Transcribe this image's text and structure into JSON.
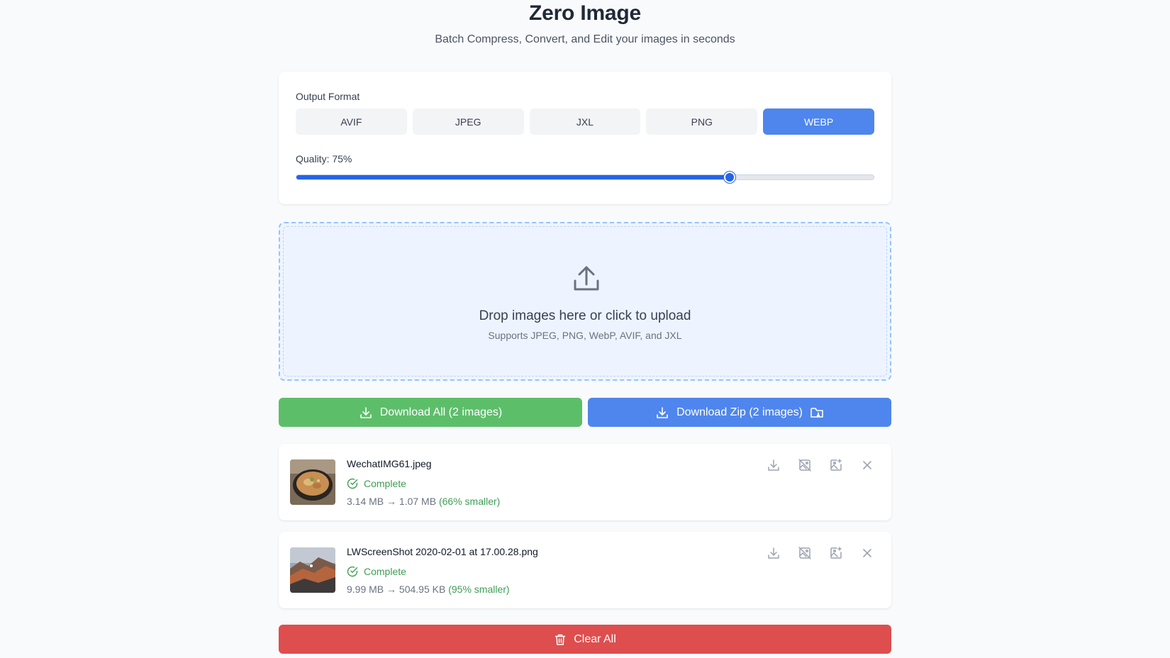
{
  "header": {
    "title": "Zero Image",
    "subtitle": "Batch Compress, Convert, and Edit your images in seconds"
  },
  "settings": {
    "format_label": "Output Format",
    "formats": [
      "AVIF",
      "JPEG",
      "JXL",
      "PNG",
      "WEBP"
    ],
    "selected_format": "WEBP",
    "quality_label": "Quality: 75%",
    "quality_value": 75
  },
  "dropzone": {
    "icon": "upload-icon",
    "title": "Drop images here or click to upload",
    "subtitle": "Supports JPEG, PNG, WebP, AVIF, and JXL"
  },
  "download": {
    "all_label": "Download All (2 images)",
    "zip_label": "Download Zip (2 images)"
  },
  "files": [
    {
      "name": "WechatIMG61.jpeg",
      "status": "Complete",
      "original_size": "3.14 MB",
      "arrow": "→",
      "new_size": "1.07 MB",
      "savings": "(66% smaller)"
    },
    {
      "name": "LWScreenShot 2020-02-01 at 17.00.28.png",
      "status": "Complete",
      "original_size": "9.99 MB",
      "arrow": "→",
      "new_size": "504.95 KB",
      "savings": "(95% smaller)"
    }
  ],
  "clear_label": "Clear All",
  "colors": {
    "primary_blue": "#4f86ed",
    "success_green": "#5dbe6a",
    "danger_red": "#de4e4e",
    "status_green": "#3f9d55"
  }
}
